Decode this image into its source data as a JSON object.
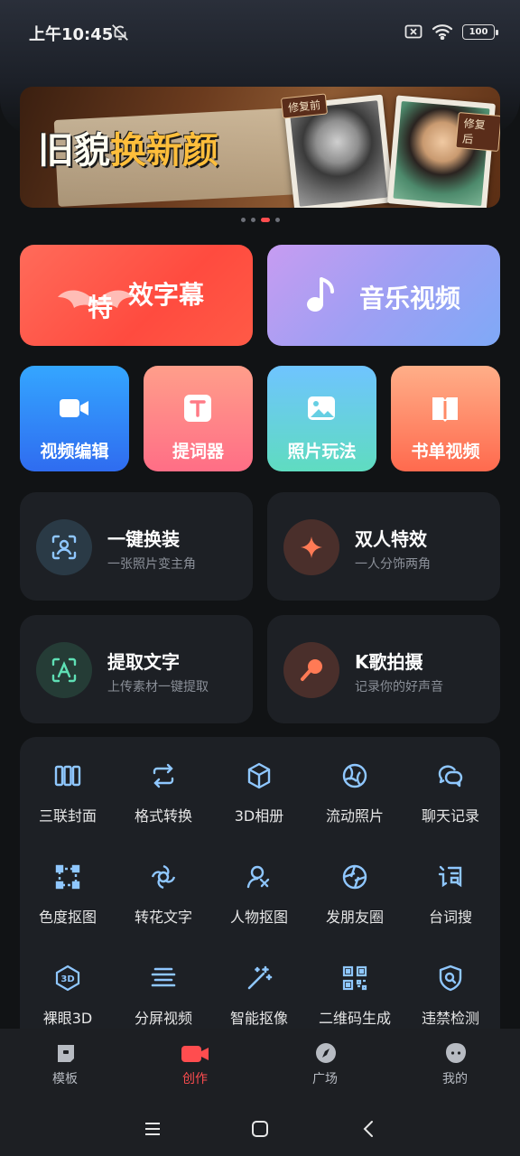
{
  "status": {
    "time": "上午10:45",
    "battery": "100"
  },
  "banner": {
    "title_part1": "旧貌",
    "title_part2": "换新颜",
    "tag_before": "修复前",
    "tag_after": "修复后"
  },
  "carousel": {
    "count": 4,
    "active_index": 2
  },
  "feature_primary": [
    {
      "label": "效字幕",
      "prefix": "特"
    },
    {
      "label": "音乐视频"
    }
  ],
  "feature_secondary": [
    {
      "label": "视频编辑",
      "icon": "video-camera-icon"
    },
    {
      "label": "提词器",
      "icon": "text-t-icon"
    },
    {
      "label": "照片玩法",
      "icon": "photo-icon"
    },
    {
      "label": "书单视频",
      "icon": "book-icon"
    }
  ],
  "cards": [
    {
      "title": "一键换装",
      "subtitle": "一张照片变主角",
      "icon": "person-scan-icon",
      "circle_color": "#2a3a46",
      "icon_color": "#8fc7ff"
    },
    {
      "title": "双人特效",
      "subtitle": "一人分饰两角",
      "icon": "sparkle-icon",
      "circle_color": "#4a2f2b",
      "icon_color": "#ff7a55"
    },
    {
      "title": "提取文字",
      "subtitle": "上传素材一键提取",
      "icon": "text-scan-icon",
      "circle_color": "#253c36",
      "icon_color": "#5fe0b5"
    },
    {
      "title": "K歌拍摄",
      "subtitle": "记录你的好声音",
      "icon": "microphone-icon",
      "circle_color": "#4a2f2b",
      "icon_color": "#ff7a55"
    }
  ],
  "tools": [
    {
      "label": "三联封面",
      "icon": "triptych-icon"
    },
    {
      "label": "格式转换",
      "icon": "convert-icon"
    },
    {
      "label": "3D相册",
      "icon": "cube-icon"
    },
    {
      "label": "流动照片",
      "icon": "aperture-flow-icon"
    },
    {
      "label": "聊天记录",
      "icon": "chat-icon"
    },
    {
      "label": "色度抠图",
      "icon": "crop-select-icon"
    },
    {
      "label": "转花文字",
      "icon": "flower-text-icon"
    },
    {
      "label": "人物抠图",
      "icon": "person-cutout-icon"
    },
    {
      "label": "发朋友圈",
      "icon": "shutter-icon"
    },
    {
      "label": "台词搜",
      "icon": "word-ci-icon"
    },
    {
      "label": "裸眼3D",
      "icon": "3d-badge-icon"
    },
    {
      "label": "分屏视频",
      "icon": "split-screen-icon"
    },
    {
      "label": "智能抠像",
      "icon": "magic-wand-icon"
    },
    {
      "label": "二维码生成",
      "icon": "qr-code-icon"
    },
    {
      "label": "违禁检测",
      "icon": "shield-check-icon"
    }
  ],
  "tabs": [
    {
      "label": "模板",
      "icon": "template-icon",
      "active": false
    },
    {
      "label": "创作",
      "icon": "camera-create-icon",
      "active": true
    },
    {
      "label": "广场",
      "icon": "compass-icon",
      "active": false
    },
    {
      "label": "我的",
      "icon": "face-icon",
      "active": false
    }
  ],
  "colors": {
    "accent": "#ff4d4f",
    "tool_icon": "#8fc7ff"
  }
}
